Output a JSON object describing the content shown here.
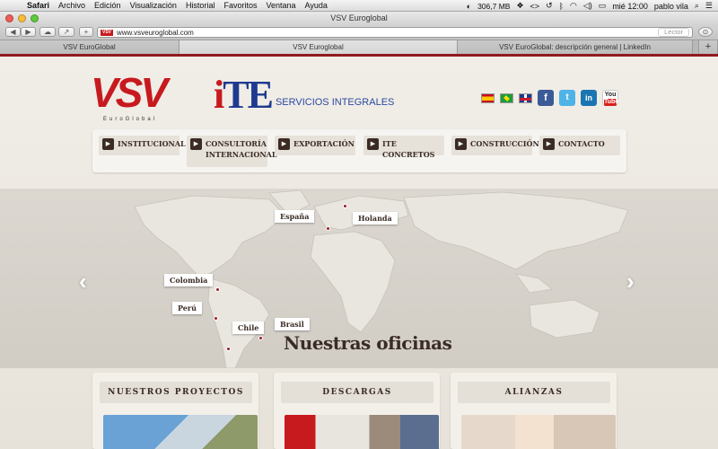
{
  "menubar": {
    "app": "Safari",
    "items": [
      "Archivo",
      "Edición",
      "Visualización",
      "Historial",
      "Favoritos",
      "Ventana",
      "Ayuda"
    ],
    "memory": "306,7 MB",
    "clock": "mié 12:00",
    "user": "pablo vila"
  },
  "window": {
    "title": "VSV Euroglobal",
    "url": "www.vsveuroglobal.com",
    "reader": "Lector",
    "tabs": [
      {
        "label": "VSV EuroGlobal",
        "active": false
      },
      {
        "label": "VSV Euroglobal",
        "active": true
      },
      {
        "label": "VSV EuroGlobal: descripción general | LinkedIn",
        "active": false
      }
    ]
  },
  "site": {
    "logo_vsv": "VSV",
    "logo_vsv_sub": "EuroGlobal",
    "logo_ite_i": "i",
    "logo_ite_te": "TE",
    "logo_ite_sub": "SERVICIOS INTEGRALES",
    "social": [
      "facebook",
      "twitter",
      "linkedin",
      "youtube"
    ],
    "social_text": {
      "fb": "f",
      "tw": "t",
      "in": "in",
      "yt_top": "You",
      "yt_bottom": "Tube"
    },
    "colors": {
      "brand_red": "#c71a1f",
      "brand_blue": "#1f3a8f",
      "nav_dark": "#3a2c25"
    },
    "nav": [
      {
        "label": "INSTITUCIONAL"
      },
      {
        "label": "CONSULTORÍA INTERNACIONAL"
      },
      {
        "label": "EXPORTACIÓN"
      },
      {
        "label": "ITE CONCRETOS"
      },
      {
        "label": "CONSTRUCCIÓN"
      },
      {
        "label": "CONTACTO"
      }
    ],
    "slider": {
      "title": "Nuestras oficinas",
      "offices": [
        "España",
        "Holanda",
        "Colombia",
        "Perú",
        "Chile",
        "Brasil"
      ]
    },
    "panels": [
      {
        "title": "NUESTROS PROYECTOS"
      },
      {
        "title": "DESCARGAS"
      },
      {
        "title": "ALIANZAS"
      }
    ]
  }
}
